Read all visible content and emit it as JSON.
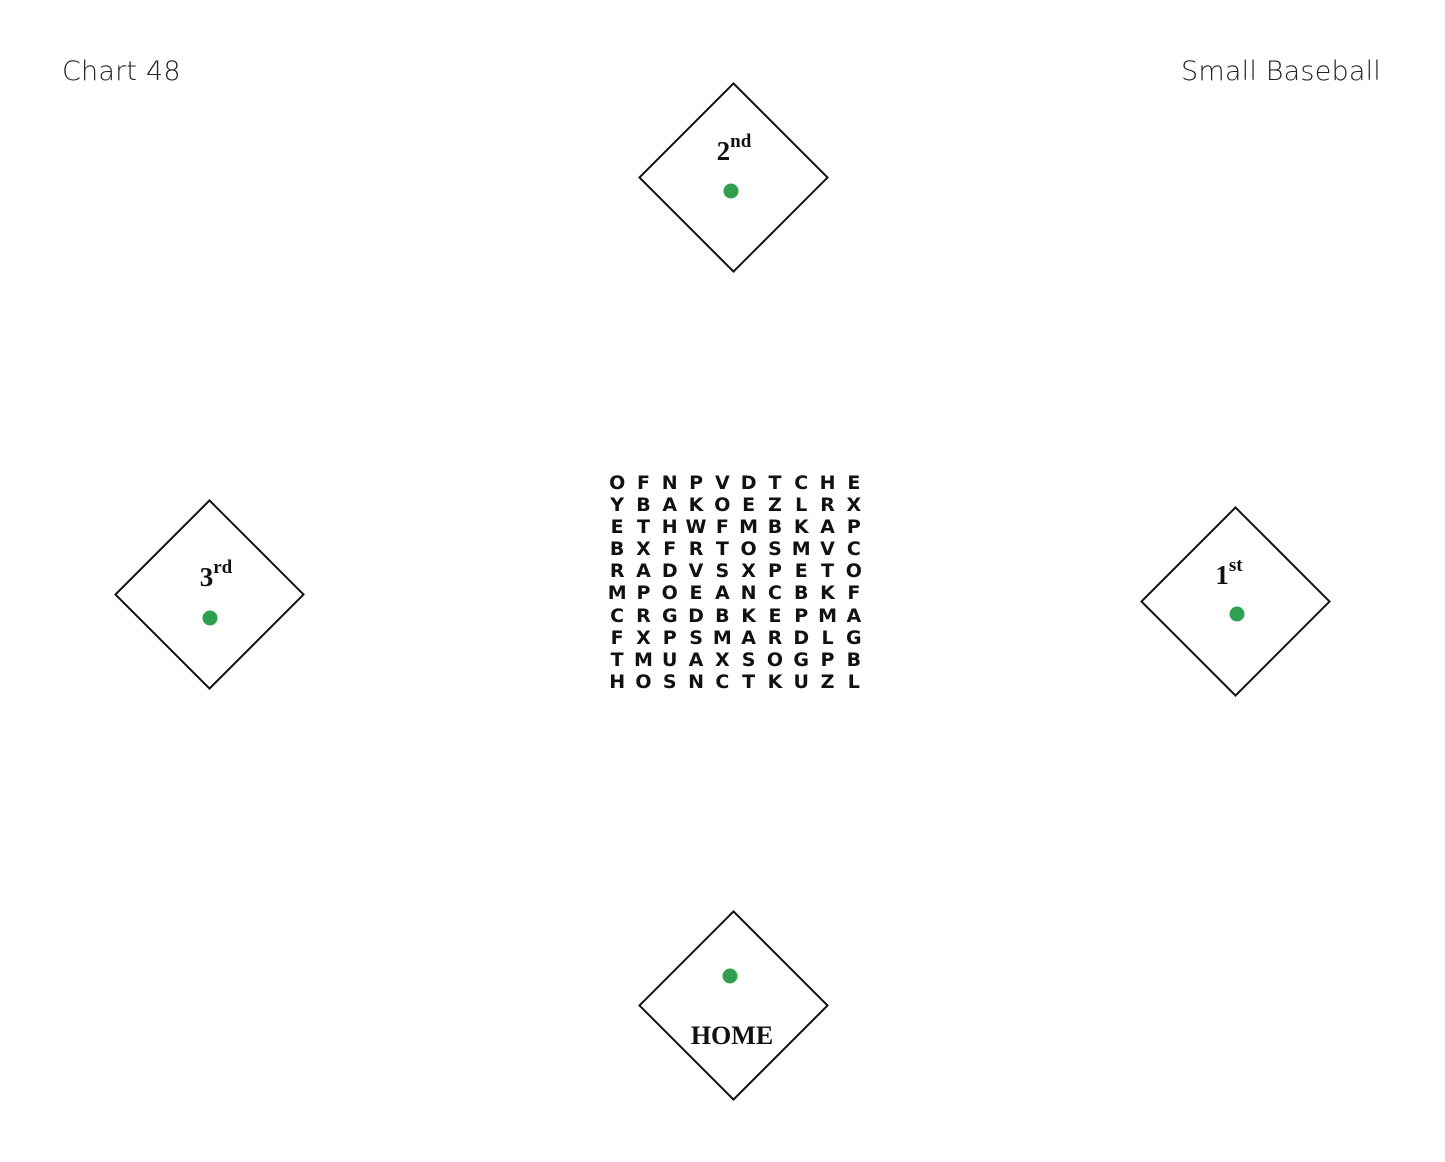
{
  "header": {
    "chart_number": "Chart 48",
    "chart_name": "Small Baseball"
  },
  "bases": {
    "second": {
      "number": "2",
      "suffix": "nd"
    },
    "third": {
      "number": "3",
      "suffix": "rd"
    },
    "first": {
      "number": "1",
      "suffix": "st"
    },
    "home": {
      "label": "HOME"
    }
  },
  "colors": {
    "dot": "#2ea04f",
    "outline": "#111111"
  },
  "letter_grid": [
    [
      "O",
      "F",
      "N",
      "P",
      "V",
      "D",
      "T",
      "C",
      "H",
      "E"
    ],
    [
      "Y",
      "B",
      "A",
      "K",
      "O",
      "E",
      "Z",
      "L",
      "R",
      "X"
    ],
    [
      "E",
      "T",
      "H",
      "W",
      "F",
      "M",
      "B",
      "K",
      "A",
      "P"
    ],
    [
      "B",
      "X",
      "F",
      "R",
      "T",
      "O",
      "S",
      "M",
      "V",
      "C"
    ],
    [
      "R",
      "A",
      "D",
      "V",
      "S",
      "X",
      "P",
      "E",
      "T",
      "O"
    ],
    [
      "M",
      "P",
      "O",
      "E",
      "A",
      "N",
      "C",
      "B",
      "K",
      "F"
    ],
    [
      "C",
      "R",
      "G",
      "D",
      "B",
      "K",
      "E",
      "P",
      "M",
      "A"
    ],
    [
      "F",
      "X",
      "P",
      "S",
      "M",
      "A",
      "R",
      "D",
      "L",
      "G"
    ],
    [
      "T",
      "M",
      "U",
      "A",
      "X",
      "S",
      "O",
      "G",
      "P",
      "B"
    ],
    [
      "H",
      "O",
      "S",
      "N",
      "C",
      "T",
      "K",
      "U",
      "Z",
      "L"
    ]
  ]
}
